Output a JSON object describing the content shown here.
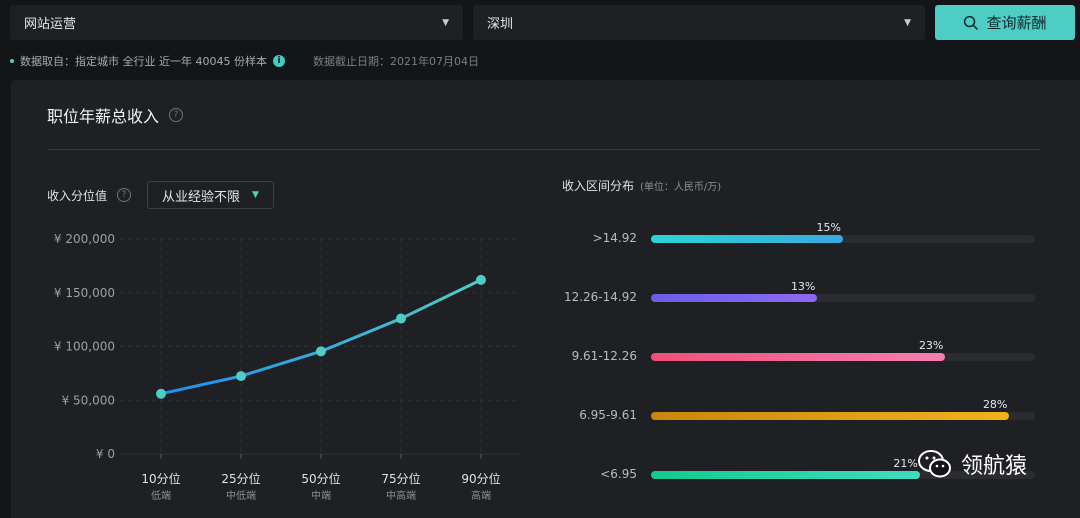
{
  "filters": {
    "job": "网站运营",
    "city": "深圳",
    "search_label": "查询薪酬"
  },
  "meta": {
    "source": "数据取自：指定城市 全行业 近一年 40045 份样本",
    "cutoff": "数据截止日期：2021年07月04日"
  },
  "panel": {
    "title": "职位年薪总收入",
    "left_title": "收入分位值",
    "experience": "从业经验不限",
    "right_title": "收入区间分布",
    "right_unit": "(单位：人民币/万)"
  },
  "colors": {
    "accent": "#4ecdc4",
    "line_start": "#1e8ff0",
    "line_end": "#4ecdc4"
  },
  "chart_data": [
    {
      "type": "line",
      "title": "收入分位值",
      "categories": [
        "10分位",
        "25分位",
        "50分位",
        "75分位",
        "90分位"
      ],
      "sub_labels": [
        "低端",
        "中低端",
        "中端",
        "中高端",
        "高端"
      ],
      "y_ticks": [
        "¥ 0",
        "¥ 50,000",
        "¥ 100,000",
        "¥ 150,000",
        "¥ 200,000"
      ],
      "ylim": [
        0,
        200000
      ],
      "grid": true,
      "series": [
        {
          "values": [
            56000,
            72500,
            95500,
            126000,
            162000
          ]
        }
      ]
    },
    {
      "type": "bar",
      "title": "收入区间分布",
      "unit": "(单位：人民币/万)",
      "categories": [
        ">14.92",
        "12.26-14.92",
        "9.61-12.26",
        "6.95-9.61",
        "<6.95"
      ],
      "values": [
        15,
        13,
        23,
        28,
        21
      ],
      "labels": [
        "15%",
        "13%",
        "23%",
        "28%",
        "21%"
      ],
      "max": 30,
      "colors": [
        [
          "#2bd4d2",
          "#3ba9e0"
        ],
        [
          "#6a5ee8",
          "#8e69f0"
        ],
        [
          "#f0507a",
          "#f57fb0"
        ],
        [
          "#c8860f",
          "#f2b21c"
        ],
        [
          "#14c98f",
          "#3fdcc0"
        ]
      ]
    }
  ],
  "watermark": {
    "text": "领航猿"
  }
}
